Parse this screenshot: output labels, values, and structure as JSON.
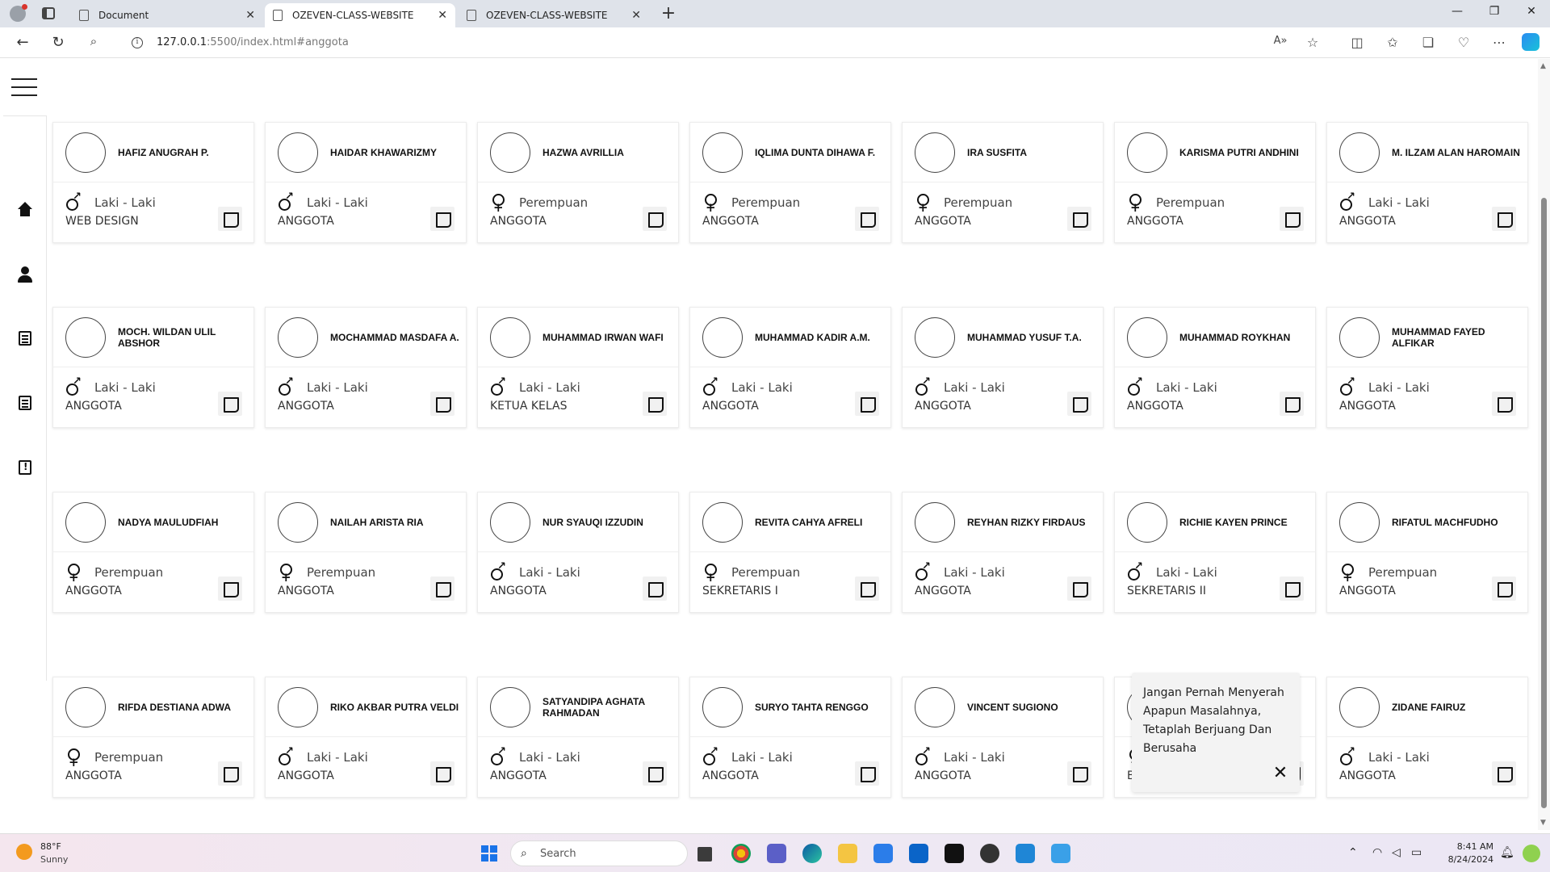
{
  "browser": {
    "tabs": [
      {
        "title": "Document",
        "active": false
      },
      {
        "title": "OZEVEN-CLASS-WEBSITE",
        "active": true
      },
      {
        "title": "OZEVEN-CLASS-WEBSITE",
        "active": false
      }
    ],
    "url_host": "127.0.0.1",
    "url_rest": ":5500/index.html#anggota"
  },
  "members": [
    {
      "name": "HAFIZ ANUGRAH P.",
      "gender": "Laki - Laki",
      "role": "WEB DESIGN"
    },
    {
      "name": "HAIDAR KHAWARIZMY",
      "gender": "Laki - Laki",
      "role": "ANGGOTA"
    },
    {
      "name": "HAZWA AVRILLIA",
      "gender": "Perempuan",
      "role": "ANGGOTA"
    },
    {
      "name": "IQLIMA DUNTA DIHAWA F.",
      "gender": "Perempuan",
      "role": "ANGGOTA"
    },
    {
      "name": "IRA SUSFITA",
      "gender": "Perempuan",
      "role": "ANGGOTA"
    },
    {
      "name": "KARISMA PUTRI ANDHINI",
      "gender": "Perempuan",
      "role": "ANGGOTA"
    },
    {
      "name": "M. ILZAM ALAN HAROMAIN",
      "gender": "Laki - Laki",
      "role": "ANGGOTA"
    },
    {
      "name": "MOCH. WILDAN ULIL ABSHOR",
      "gender": "Laki - Laki",
      "role": "ANGGOTA"
    },
    {
      "name": "MOCHAMMAD MASDAFA A.",
      "gender": "Laki - Laki",
      "role": "ANGGOTA"
    },
    {
      "name": "MUHAMMAD IRWAN WAFI",
      "gender": "Laki - Laki",
      "role": "KETUA KELAS"
    },
    {
      "name": "MUHAMMAD KADIR A.M.",
      "gender": "Laki - Laki",
      "role": "ANGGOTA"
    },
    {
      "name": "MUHAMMAD YUSUF T.A.",
      "gender": "Laki - Laki",
      "role": "ANGGOTA"
    },
    {
      "name": "MUHAMMAD ROYKHAN",
      "gender": "Laki - Laki",
      "role": "ANGGOTA"
    },
    {
      "name": "MUHAMMAD FAYED ALFIKAR",
      "gender": "Laki - Laki",
      "role": "ANGGOTA"
    },
    {
      "name": "NADYA MAULUDFIAH",
      "gender": "Perempuan",
      "role": "ANGGOTA"
    },
    {
      "name": "NAILAH ARISTA RIA",
      "gender": "Perempuan",
      "role": "ANGGOTA"
    },
    {
      "name": "NUR SYAUQI IZZUDIN",
      "gender": "Laki - Laki",
      "role": "ANGGOTA"
    },
    {
      "name": "REVITA CAHYA AFRELI",
      "gender": "Perempuan",
      "role": "SEKRETARIS I"
    },
    {
      "name": "REYHAN RIZKY FIRDAUS",
      "gender": "Laki - Laki",
      "role": "ANGGOTA"
    },
    {
      "name": "RICHIE KAYEN PRINCE",
      "gender": "Laki - Laki",
      "role": "SEKRETARIS II"
    },
    {
      "name": "RIFATUL MACHFUDHO",
      "gender": "Perempuan",
      "role": "ANGGOTA"
    },
    {
      "name": "RIFDA DESTIANA ADWA",
      "gender": "Perempuan",
      "role": "ANGGOTA"
    },
    {
      "name": "RIKO AKBAR PUTRA VELDI",
      "gender": "Laki - Laki",
      "role": "ANGGOTA"
    },
    {
      "name": "SATYANDIPA AGHATA RAHMADAN",
      "gender": "Laki - Laki",
      "role": "ANGGOTA"
    },
    {
      "name": "SURYO TAHTA RENGGO",
      "gender": "Laki - Laki",
      "role": "ANGGOTA"
    },
    {
      "name": "VINCENT SUGIONO",
      "gender": "Laki - Laki",
      "role": "ANGGOTA"
    },
    {
      "name": "",
      "gender": "Perempuan",
      "role": "BENDAHARA I"
    },
    {
      "name": "ZIDANE FAIRUZ",
      "gender": "Laki - Laki",
      "role": "ANGGOTA"
    }
  ],
  "quote_popup": {
    "text": "Jangan Pernah Menyerah Apapun Masalahnya, Tetaplah Berjuang Dan Berusaha",
    "close": "✕"
  },
  "sidebar": {
    "items": [
      {
        "icon": "home-icon"
      },
      {
        "icon": "user-icon"
      },
      {
        "icon": "document-icon"
      },
      {
        "icon": "document-icon"
      },
      {
        "icon": "report-icon"
      }
    ]
  },
  "taskbar": {
    "weather_temp": "88°F",
    "weather_desc": "Sunny",
    "search_label": "Search",
    "time": "8:41 AM",
    "date": "8/24/2024"
  }
}
